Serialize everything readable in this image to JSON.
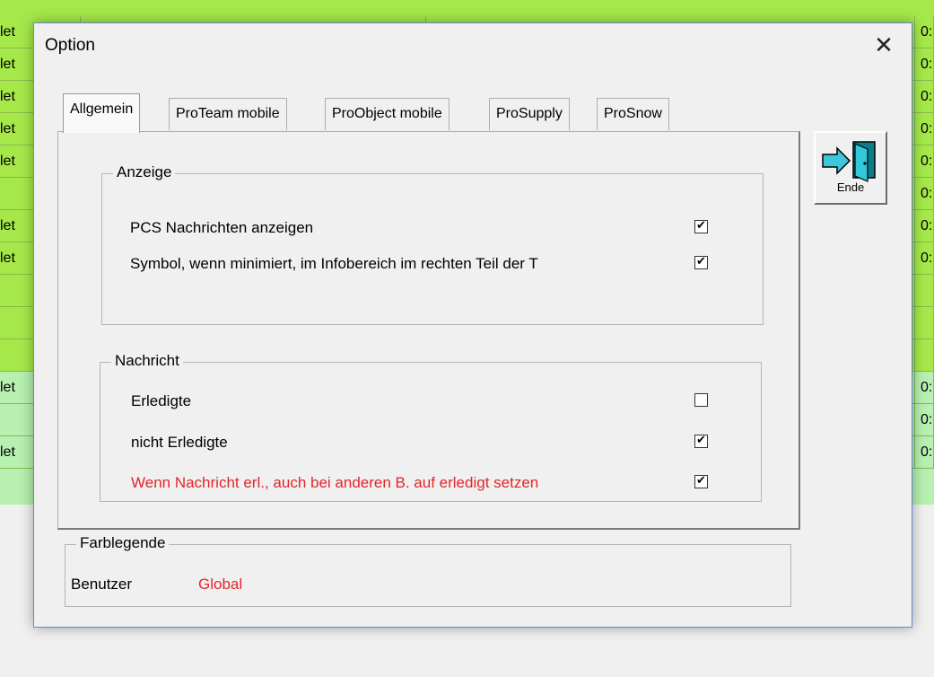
{
  "background": {
    "left_labels": [
      "let",
      "let",
      "let",
      "let",
      "let",
      "",
      "let",
      "let",
      "",
      "",
      "",
      "let",
      "",
      "let"
    ],
    "right_labels": [
      "0:",
      "0:",
      "0:",
      "0:",
      "0:",
      "0:",
      "0:",
      "0:",
      "",
      "",
      "",
      "0:",
      "0:",
      "0:"
    ],
    "row_colors": [
      "#a6e84a",
      "#a6e84a",
      "#a6e84a",
      "#a6e84a",
      "#a6e84a",
      "#a6e84a",
      "#a6e84a",
      "#a6e84a",
      "#a6e84a",
      "#a6e84a",
      "#a6e84a",
      "#b7f0b0",
      "#b7f0b0",
      "#b7f0b0"
    ]
  },
  "dialog": {
    "title": "Option",
    "close_label": "✕",
    "tabs": [
      "Allgemein",
      "ProTeam mobile",
      "ProObject mobile",
      "ProSupply",
      "ProSnow"
    ],
    "active_tab": "Allgemein",
    "anzeige": {
      "legend": "Anzeige",
      "items": [
        {
          "label": "PCS Nachrichten anzeigen",
          "checked": true
        },
        {
          "label": "Symbol, wenn minimiert, im Infobereich im rechten Teil der T",
          "checked": true
        }
      ]
    },
    "nachricht": {
      "legend": "Nachricht",
      "items": [
        {
          "label": "Erledigte",
          "checked": false,
          "color": "#000000"
        },
        {
          "label": "nicht Erledigte",
          "checked": true,
          "color": "#000000"
        },
        {
          "label": "Wenn Nachricht erl., auch bei anderen B. auf erledigt setzen",
          "checked": true,
          "color": "#e5242a"
        }
      ]
    },
    "exit_button": {
      "label": "Ende",
      "icon": "exit-door-icon"
    },
    "farblegende": {
      "legend": "Farblegende",
      "benutzer": "Benutzer",
      "global": "Global",
      "global_color": "#e5242a"
    }
  }
}
